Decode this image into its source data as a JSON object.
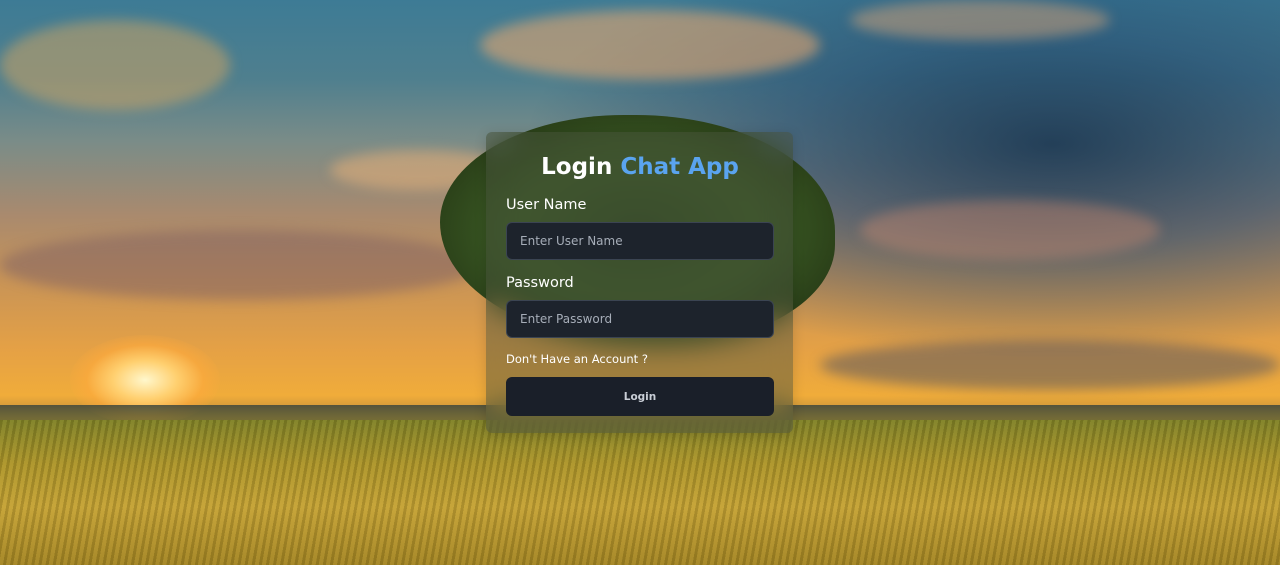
{
  "background": {
    "description_icon": "sunset-field-landscape"
  },
  "login_form": {
    "title_prefix": "Login",
    "title_accent": "Chat App",
    "accent_color": "#5aa4ef",
    "username": {
      "label": "User Name",
      "placeholder": "Enter User Name",
      "value": ""
    },
    "password": {
      "label": "Password",
      "placeholder": "Enter Password",
      "value": ""
    },
    "signup_link": "Don't Have an Account ?",
    "submit_label": "Login"
  }
}
